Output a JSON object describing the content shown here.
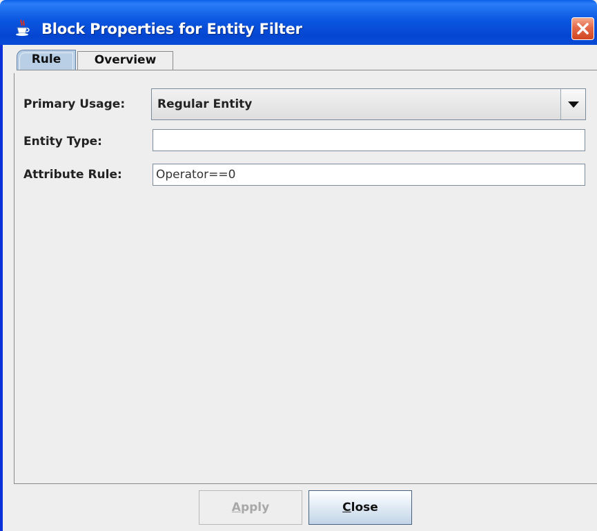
{
  "window": {
    "title": "Block Properties for Entity Filter",
    "title_icon": "java-cup-icon",
    "close_icon": "close-x-icon"
  },
  "tabs": [
    {
      "label": "Rule",
      "selected": true
    },
    {
      "label": "Overview",
      "selected": false
    }
  ],
  "form": {
    "primary_usage": {
      "label": "Primary Usage:",
      "value": "Regular Entity"
    },
    "entity_type": {
      "label": "Entity Type:",
      "value": ""
    },
    "attribute_rule": {
      "label": "Attribute Rule:",
      "value": "Operator==0"
    }
  },
  "buttons": {
    "apply": {
      "mnemonic": "A",
      "rest": "pply",
      "enabled": false
    },
    "close": {
      "mnemonic": "C",
      "rest": "lose",
      "enabled": true
    }
  }
}
